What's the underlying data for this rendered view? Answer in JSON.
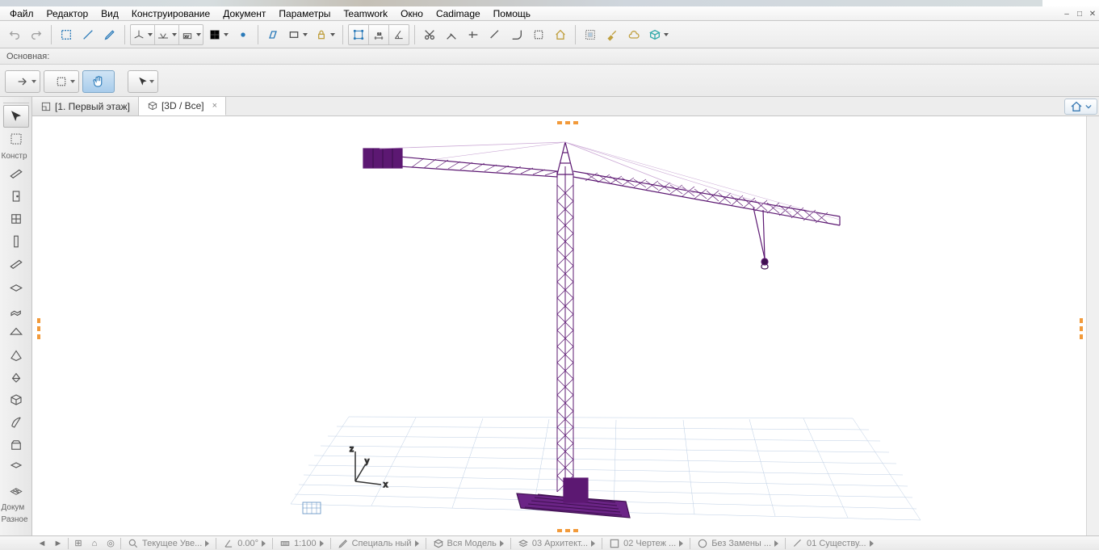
{
  "menu": {
    "items": [
      "Файл",
      "Редактор",
      "Вид",
      "Конструирование",
      "Документ",
      "Параметры",
      "Teamwork",
      "Окно",
      "Cadimage",
      "Помощь"
    ]
  },
  "window_controls": {
    "min": "–",
    "max": "□",
    "close": "✕"
  },
  "infobar": {
    "label": "Основная:"
  },
  "tabs": [
    {
      "icon": "floorplan",
      "label": "[1. Первый этаж]",
      "active": false,
      "closeable": false
    },
    {
      "icon": "cube3d",
      "label": "[3D / Все]",
      "active": true,
      "closeable": true
    }
  ],
  "toolbox_sections": {
    "s1": "Констр",
    "s2": "Докум",
    "s3": "Разное"
  },
  "statusbar": {
    "label1": "Текущее Уве...",
    "angle": "0.00°",
    "scale": "1:100",
    "style": "Специаль ный",
    "model": "Вся Модель",
    "layer": "03 Архитект...",
    "drawing": "02 Чертеж ...",
    "replace": "Без Замены ...",
    "exist": "01 Существу..."
  },
  "axes": {
    "x": "x",
    "y": "y",
    "z": "z"
  }
}
